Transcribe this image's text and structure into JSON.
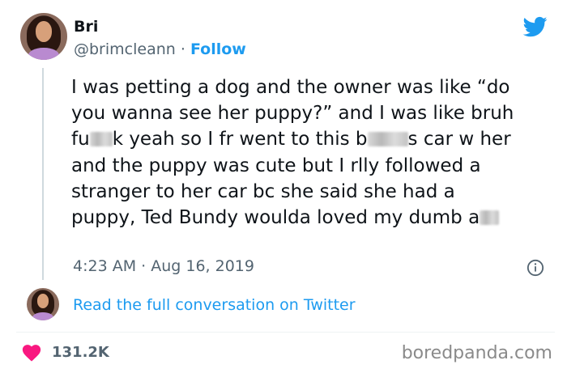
{
  "author": {
    "name": "Bri",
    "handle": "@brimcleann",
    "separator": "·",
    "follow_label": "Follow"
  },
  "tweet": {
    "text_parts": [
      "I was petting a dog and the owner was like “do you wanna see her puppy?” and I was like bruh fu",
      "k yeah so I fr went to this b",
      "s car w her and the puppy was cute but I rlly followed a stranger to her car bc she said she had a puppy, Ted Bundy woulda loved my dumb a"
    ],
    "timestamp": "4:23 AM · Aug 16, 2019"
  },
  "conversation_link": "Read the full conversation on Twitter",
  "likes": "131.2K",
  "watermark": "boredpanda.com",
  "colors": {
    "accent": "#1d9bf0",
    "heart": "#f91880",
    "secondary_text": "#536471"
  },
  "icons": [
    "twitter-bird-icon",
    "info-icon",
    "heart-icon"
  ]
}
